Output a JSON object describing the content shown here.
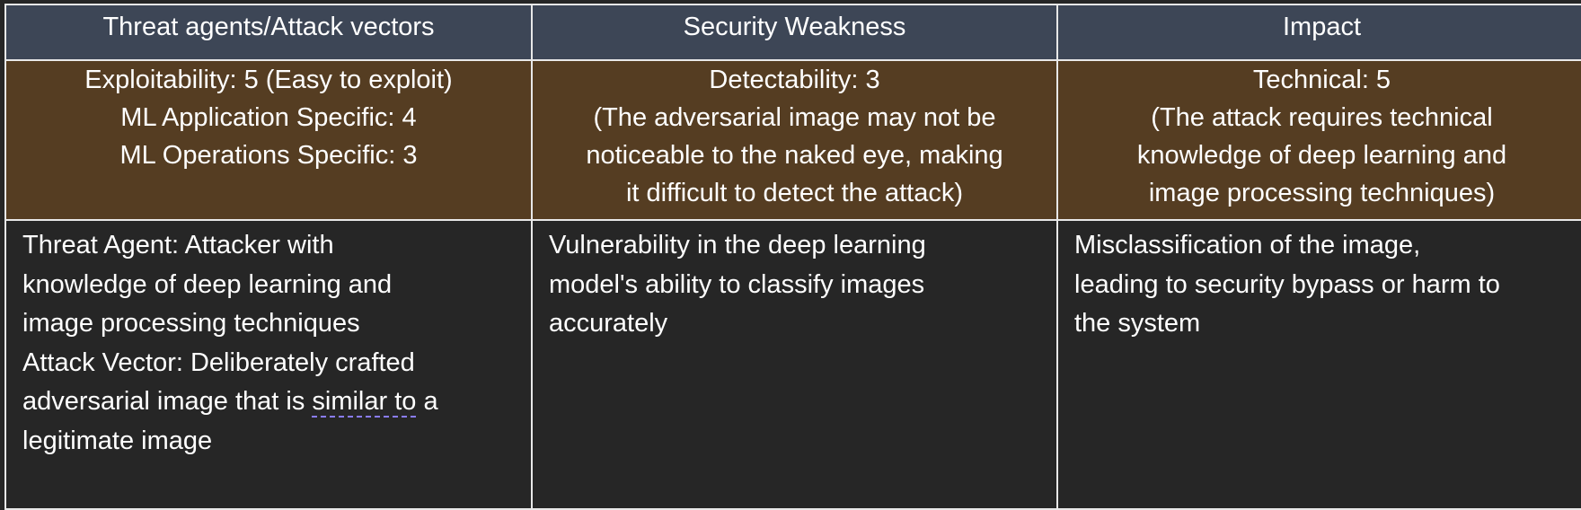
{
  "headers": {
    "col1": "Threat agents/Attack vectors",
    "col2": "Security Weakness",
    "col3": "Impact"
  },
  "ratings": {
    "col1": {
      "lines": [
        "Exploitability: 5 (Easy to exploit)",
        "ML Application Specific: 4",
        "ML Operations Specific: 3"
      ]
    },
    "col2": {
      "lines": [
        "Detectability: 3",
        "(The adversarial image may not be",
        "noticeable to the naked eye, making",
        "it difficult to detect the attack)"
      ]
    },
    "col3": {
      "lines": [
        "Technical: 5",
        "(The attack requires technical",
        "knowledge of deep learning and",
        "image processing techniques)"
      ]
    }
  },
  "details": {
    "col1": {
      "lines": [
        "Threat Agent: Attacker with",
        "knowledge of deep learning and",
        "image processing techniques",
        "Attack Vector: Deliberately crafted"
      ],
      "last_line_prefix": "adversarial image that is ",
      "last_line_underlined": "similar to",
      "last_line_suffix": " a",
      "final_line": "legitimate image"
    },
    "col2": {
      "lines": [
        "Vulnerability in the deep learning",
        "model's ability to classify images",
        "accurately"
      ]
    },
    "col3": {
      "lines": [
        "Misclassification of the image,",
        "leading to security bypass or harm to",
        "the system"
      ]
    }
  },
  "colors": {
    "header_bg": "#3d4656",
    "rating_bg": "#553d22",
    "detail_bg": "#262626",
    "border": "#e8e8e8",
    "text": "#ffffff",
    "spellcheck_underline": "#8a7dff"
  }
}
